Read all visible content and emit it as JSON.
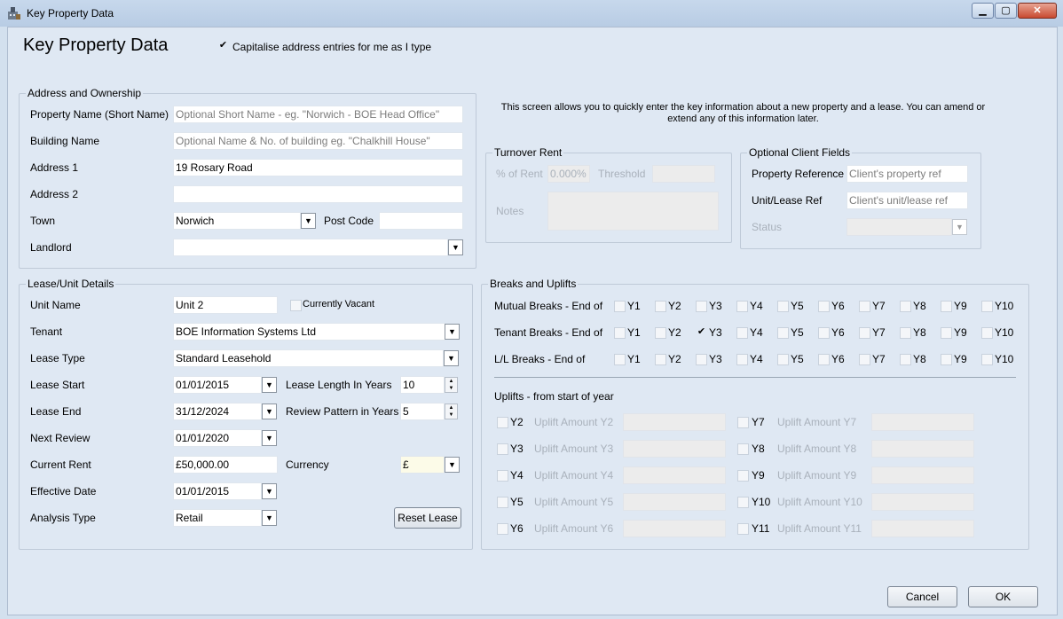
{
  "window": {
    "title": "Key Property Data"
  },
  "header": {
    "title": "Key Property Data",
    "capitalise_label": "Capitalise address entries for me as I type",
    "capitalise_checked": true
  },
  "address": {
    "title": "Address and Ownership",
    "property_name_label": "Property Name (Short Name)",
    "property_name_placeholder": "Optional Short Name - eg. \"Norwich - BOE Head Office\"",
    "building_name_label": "Building Name",
    "building_name_placeholder": "Optional Name & No. of building eg. \"Chalkhill House\"",
    "address1_label": "Address 1",
    "address1_value": "19 Rosary Road",
    "address2_label": "Address 2",
    "address2_value": "",
    "town_label": "Town",
    "town_value": "Norwich",
    "postcode_label": "Post Code",
    "postcode_value": "",
    "landlord_label": "Landlord",
    "landlord_value": ""
  },
  "info_text": "This screen allows you to quickly enter the key information about a new property and a lease. You can amend or extend any of this information later.",
  "turnover": {
    "title": "Turnover Rent",
    "pct_label": "% of Rent",
    "pct_value": "0.000%",
    "threshold_label": "Threshold",
    "threshold_value": "",
    "notes_label": "Notes",
    "notes_value": ""
  },
  "client_fields": {
    "title": "Optional Client Fields",
    "property_ref_label": "Property Reference",
    "property_ref_value": "Client's property ref",
    "unit_ref_label": "Unit/Lease Ref",
    "unit_ref_value": "Client's unit/lease ref",
    "status_label": "Status",
    "status_value": ""
  },
  "lease": {
    "title": "Lease/Unit Details",
    "unit_name_label": "Unit Name",
    "unit_name_value": "Unit 2",
    "vacant_label": "Currently Vacant",
    "vacant_checked": false,
    "tenant_label": "Tenant",
    "tenant_value": "BOE Information Systems Ltd",
    "lease_type_label": "Lease Type",
    "lease_type_value": "Standard Leasehold",
    "lease_start_label": "Lease Start",
    "lease_start_value": "01/01/2015",
    "lease_length_label": "Lease Length In Years",
    "lease_length_value": "10",
    "lease_end_label": "Lease End",
    "lease_end_value": "31/12/2024",
    "review_pattern_label": "Review Pattern in Years",
    "review_pattern_value": "5",
    "next_review_label": "Next Review",
    "next_review_value": "01/01/2020",
    "current_rent_label": "Current Rent",
    "current_rent_value": "£50,000.00",
    "currency_label": "Currency",
    "currency_value": "£",
    "effective_date_label": "Effective Date",
    "effective_date_value": "01/01/2015",
    "analysis_type_label": "Analysis Type",
    "analysis_type_value": "Retail",
    "reset_label": "Reset Lease"
  },
  "breaks": {
    "title": "Breaks and Uplifts",
    "years": [
      "Y1",
      "Y2",
      "Y3",
      "Y4",
      "Y5",
      "Y6",
      "Y7",
      "Y8",
      "Y9",
      "Y10"
    ],
    "rows": [
      {
        "label": "Mutual Breaks - End of",
        "checked": []
      },
      {
        "label": "Tenant Breaks - End of",
        "checked": [
          "Y3"
        ]
      },
      {
        "label": "L/L Breaks - End of",
        "checked": []
      }
    ],
    "uplifts_title": "Uplifts - from start of year",
    "uplifts_left": [
      {
        "year": "Y2",
        "label": "Uplift Amount Y2"
      },
      {
        "year": "Y3",
        "label": "Uplift Amount Y3"
      },
      {
        "year": "Y4",
        "label": "Uplift Amount Y4"
      },
      {
        "year": "Y5",
        "label": "Uplift Amount Y5"
      },
      {
        "year": "Y6",
        "label": "Uplift Amount Y6"
      }
    ],
    "uplifts_right": [
      {
        "year": "Y7",
        "label": "Uplift Amount Y7"
      },
      {
        "year": "Y8",
        "label": "Uplift Amount Y8"
      },
      {
        "year": "Y9",
        "label": "Uplift Amount Y9"
      },
      {
        "year": "Y10",
        "label": "Uplift Amount Y10"
      },
      {
        "year": "Y11",
        "label": "Uplift Amount Y11"
      }
    ]
  },
  "footer": {
    "cancel_label": "Cancel",
    "ok_label": "OK"
  },
  "icons": {
    "window": "building-icon",
    "dropdown": "chevron-down-icon",
    "check": "check-icon"
  }
}
